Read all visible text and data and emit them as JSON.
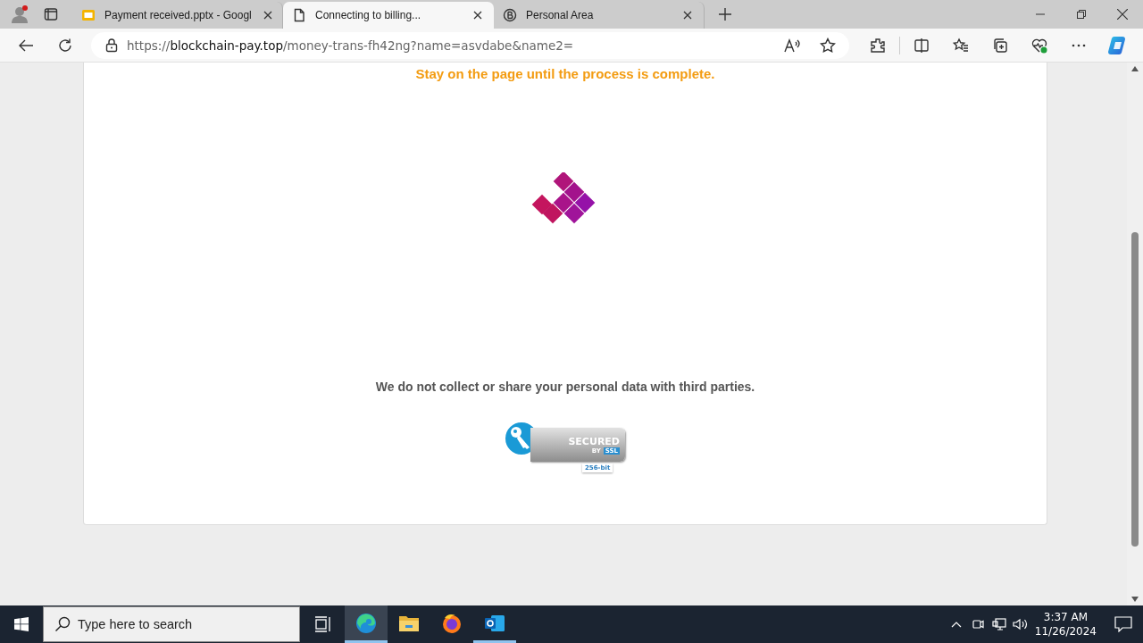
{
  "browser": {
    "tabs": [
      {
        "title": "Payment received.pptx - Googl",
        "kind": "slides",
        "selected": false
      },
      {
        "title": "Connecting to billing...",
        "kind": "page",
        "selected": true
      },
      {
        "title": "Personal Area",
        "kind": "coin",
        "selected": false
      }
    ],
    "address": {
      "scheme": "https://",
      "host": "blockchain-pay.top",
      "path": "/money-trans-fh42ng?name=asvdabe&name2="
    }
  },
  "page": {
    "notice": "Stay on the page until the process is complete.",
    "privacy": "We do not collect or share your personal data with third parties.",
    "badge": {
      "title": "SECURED",
      "by": "BY",
      "ssl": "SSL",
      "bits": "256-bit"
    }
  },
  "taskbar": {
    "search_placeholder": "Type here to search",
    "apps": [
      {
        "kind": "edge",
        "selected": true,
        "running": true
      },
      {
        "kind": "files",
        "selected": false,
        "running": false
      },
      {
        "kind": "firefox",
        "selected": false,
        "running": false
      },
      {
        "kind": "outlook",
        "selected": false,
        "running": true
      }
    ],
    "time": "3:37 AM",
    "date": "11/26/2024"
  }
}
